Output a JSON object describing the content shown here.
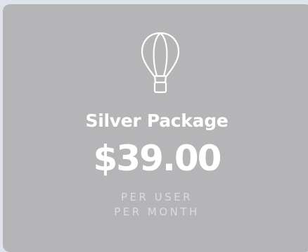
{
  "card": {
    "icon": "hot-air-balloon-icon",
    "title": "Silver Package",
    "price": "$39.00",
    "period_line1": "PER USER",
    "period_line2": "PER MONTH"
  },
  "colors": {
    "card_background": "#b5b5b8",
    "page_background": "#dfe4ec",
    "text": "#ffffff",
    "muted_text": "#dcdcdf"
  }
}
